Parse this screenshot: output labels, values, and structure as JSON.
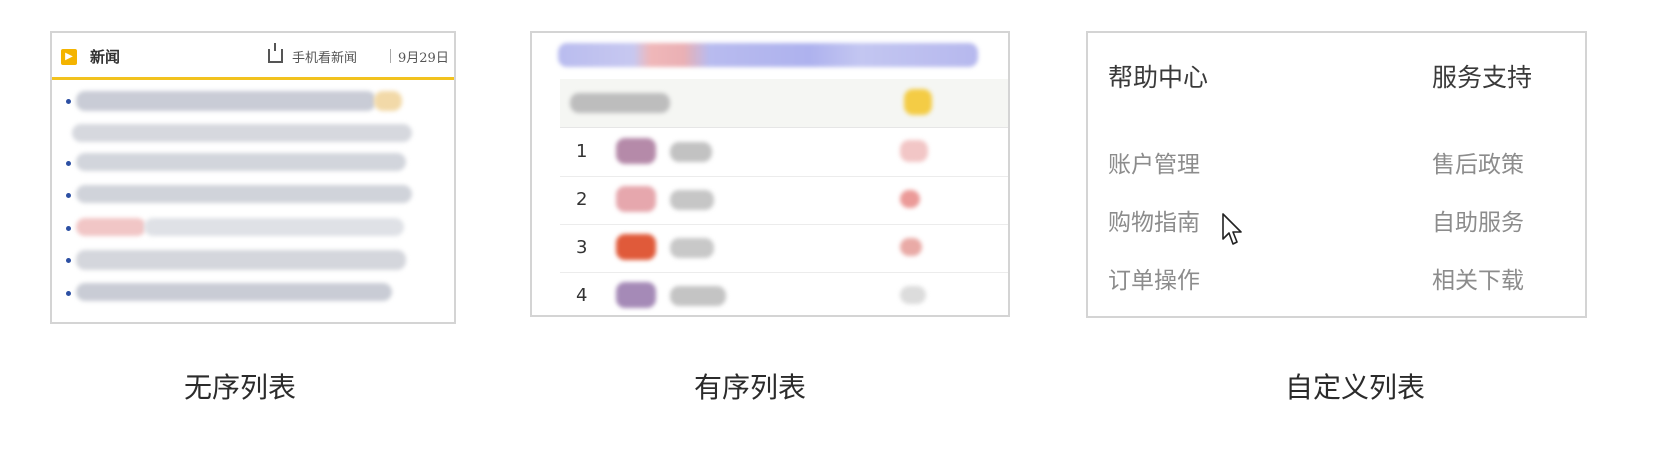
{
  "news_panel": {
    "title": "新闻",
    "mobile_link": "手机看新闻",
    "date": "9月29日",
    "icon": "play-badge-icon",
    "accent_color": "#f2c21e"
  },
  "ranking_panel": {
    "ranks": [
      "1",
      "2",
      "3",
      "4"
    ]
  },
  "help_panel": {
    "left_heading": "帮助中心",
    "right_heading": "服务支持",
    "left_items": [
      "账户管理",
      "购物指南",
      "订单操作"
    ],
    "right_items": [
      "售后政策",
      "自助服务",
      "相关下载"
    ]
  },
  "captions": {
    "unordered": "无序列表",
    "ordered": "有序列表",
    "custom": "自定义列表"
  },
  "cursor": {
    "icon": "mouse-pointer-icon"
  }
}
